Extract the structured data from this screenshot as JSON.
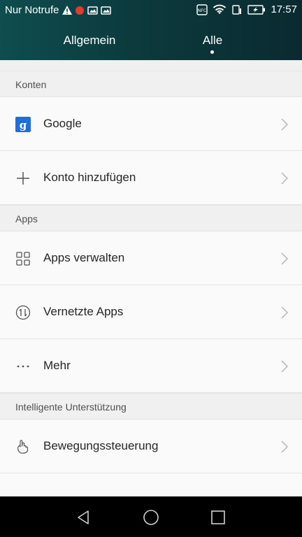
{
  "status_bar": {
    "carrier": "Nur Notrufe",
    "time": "17:57",
    "nfc_label": "NFC"
  },
  "tabs": [
    {
      "label": "Allgemein",
      "active": false
    },
    {
      "label": "Alle",
      "active": true
    }
  ],
  "sections": {
    "konten": {
      "title": "Konten",
      "items": [
        {
          "label": "Google",
          "icon": "google-icon"
        },
        {
          "label": "Konto hinzufügen",
          "icon": "plus-icon"
        }
      ]
    },
    "apps": {
      "title": "Apps",
      "items": [
        {
          "label": "Apps verwalten",
          "icon": "grid-icon"
        },
        {
          "label": "Vernetzte Apps",
          "icon": "sync-icon"
        },
        {
          "label": "Mehr",
          "icon": "more-dots-icon"
        }
      ]
    },
    "intelligent": {
      "title": "Intelligente Unterstützung",
      "items": [
        {
          "label": "Bewegungssteuerung",
          "icon": "hand-gesture-icon"
        }
      ]
    }
  },
  "navigation": {
    "back": "back-icon",
    "home": "home-icon",
    "recents": "recents-icon"
  },
  "colors": {
    "header_start": "#0f4d4f",
    "header_end": "#0a2a30",
    "google_blue": "#1e6fd9",
    "section_bg": "#f0f0f0",
    "record_red": "#e53935"
  }
}
